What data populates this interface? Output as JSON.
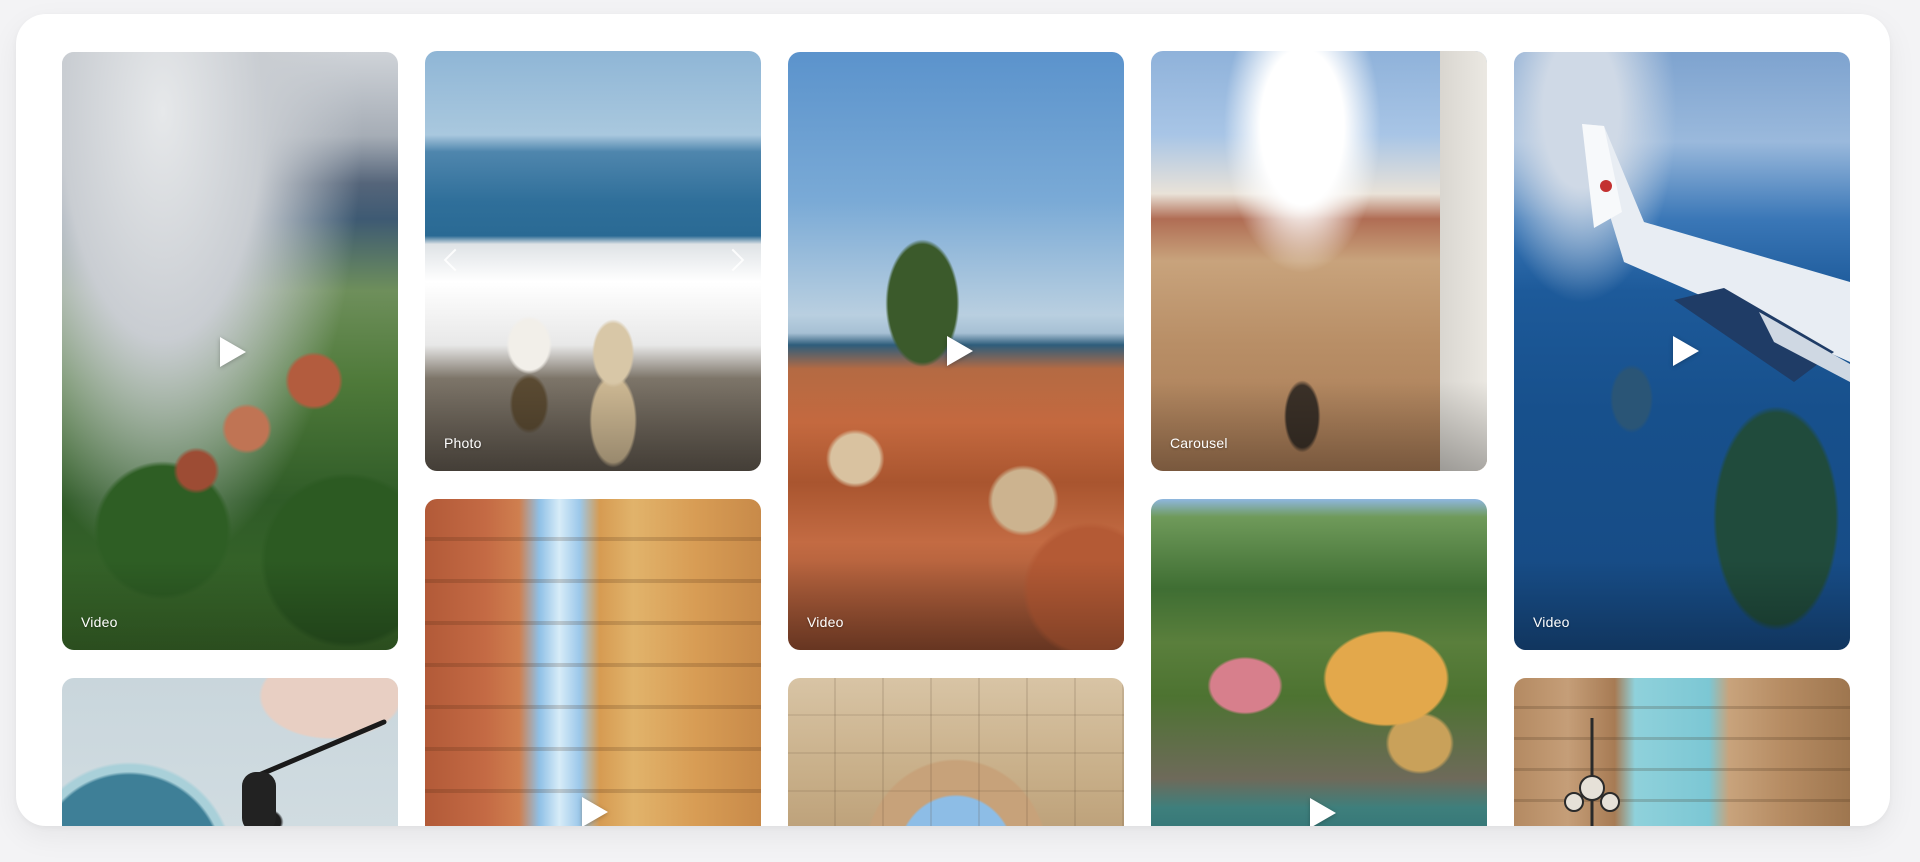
{
  "gallery": {
    "tiles": [
      {
        "id": "t1",
        "label": "Video",
        "media": "Lakeside village with mountains"
      },
      {
        "id": "t2",
        "label": "Photo",
        "media": "Couple walking on white terrace by the sea"
      },
      {
        "id": "t3",
        "label": "Video",
        "media": "Old town rooftops by the sea with island"
      },
      {
        "id": "t4",
        "label": "Carousel",
        "media": "Colorful townhouses with statue"
      },
      {
        "id": "t5",
        "label": "Video",
        "media": "Airplane wing over blue sea and island"
      },
      {
        "id": "t6",
        "label": "",
        "media": "Table with pasta and sunglasses"
      },
      {
        "id": "t7",
        "label": "",
        "media": "Narrow street with colorful buildings"
      },
      {
        "id": "t8",
        "label": "",
        "media": "Stone archway"
      },
      {
        "id": "t9",
        "label": "",
        "media": "Coastal villas and cliffs"
      },
      {
        "id": "t10",
        "label": "",
        "media": "Street with lamp posts and facades"
      }
    ]
  },
  "icons": {
    "play": "play-icon",
    "prev": "chevron-left-icon",
    "next": "chevron-right-icon"
  },
  "colors": {
    "panel_bg": "#ffffff",
    "page_bg": "#f3f3f5",
    "label_text": "#ffffff"
  }
}
